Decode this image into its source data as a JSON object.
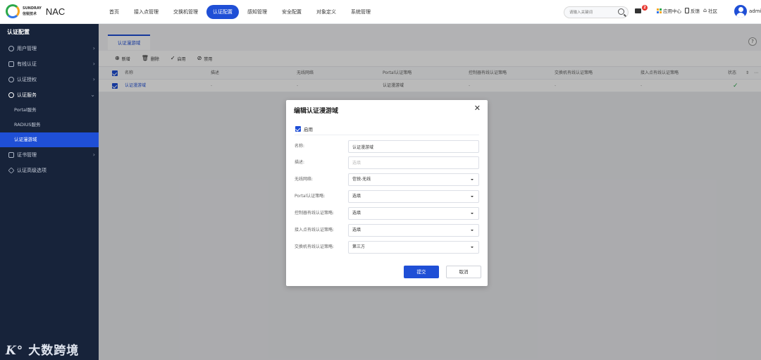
{
  "brand": {
    "logo_line1": "SUNDRAY",
    "logo_line2": "信锐技术",
    "product": "NAC"
  },
  "nav": [
    {
      "label": "首页"
    },
    {
      "label": "接入点管理"
    },
    {
      "label": "交换机管理"
    },
    {
      "label": "认证配置"
    },
    {
      "label": "感知管理"
    },
    {
      "label": "安全配置"
    },
    {
      "label": "对象定义"
    },
    {
      "label": "系统管理"
    }
  ],
  "nav_active": "认证配置",
  "search": {
    "placeholder": "请输入关键词"
  },
  "header": {
    "message_badge": "2",
    "app_center": "应用中心",
    "feedback": "反馈",
    "community": "社区",
    "user": "admi"
  },
  "sidebar": {
    "title": "认证配置",
    "items": [
      {
        "label": "用户管理",
        "icon": "user-icon"
      },
      {
        "label": "有线认证",
        "icon": "card-icon"
      },
      {
        "label": "认证授权",
        "icon": "user-key-icon"
      },
      {
        "label": "认证服务",
        "icon": "users-icon"
      },
      {
        "label": "证书管理",
        "icon": "certificate-icon"
      },
      {
        "label": "认证高级选项",
        "icon": "diamond-icon"
      }
    ],
    "sub_items": [
      {
        "label": "Portal服务"
      },
      {
        "label": "RADIUS服务"
      },
      {
        "label": "认证漫游域"
      }
    ],
    "watermark": "大数跨境"
  },
  "tab": {
    "label": "认证漫游域"
  },
  "toolbar": {
    "add": "新增",
    "delete": "删除",
    "enable": "启用",
    "disable": "禁用"
  },
  "table": {
    "columns": [
      "名称",
      "描述",
      "无线网络",
      "Portal认证策略",
      "控制器有线认证策略",
      "交换机有线认证策略",
      "接入点有线认证策略",
      "状态"
    ],
    "rows": [
      {
        "name": "认证漫游域",
        "desc": "-",
        "wireless": "-",
        "portal": "认证漫游域",
        "ctrl": "-",
        "switch": "-",
        "ap": "-"
      }
    ]
  },
  "modal": {
    "title": "编辑认证漫游域",
    "enable_label": "启用",
    "fields": {
      "name_label": "名称:",
      "name_value": "认证漫游域",
      "desc_label": "描述:",
      "desc_placeholder": "选填",
      "wireless_label": "无线网络:",
      "wireless_value": "信锐-无线",
      "portal_label": "Portal认证策略:",
      "portal_value": "选填",
      "ctrl_label": "控制器有线认证策略:",
      "ctrl_value": "选填",
      "ap_label": "接入点有线认证策略:",
      "ap_value": "选填",
      "switch_label": "交换机有线认证策略:",
      "switch_value": "第三方"
    },
    "submit": "提交",
    "cancel": "取消"
  },
  "colors": {
    "accent": "#1f4fd6",
    "sidebar_bg": "#17233a",
    "success": "#2ba84a",
    "badge": "#e7372f"
  }
}
